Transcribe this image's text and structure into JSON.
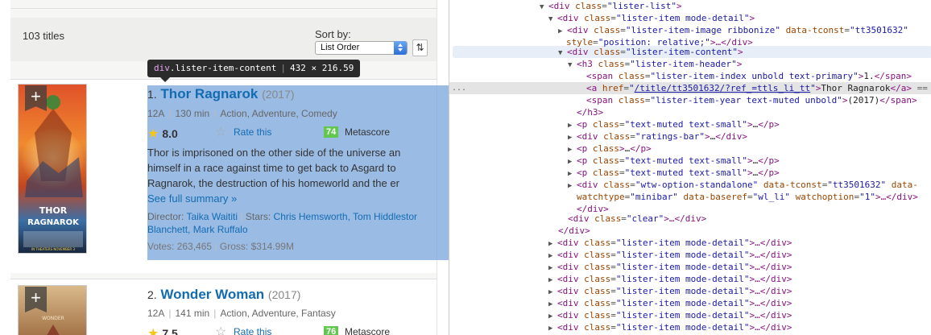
{
  "list_header": {
    "count": "103 titles",
    "sort_label": "Sort by:",
    "sort_value": "List Order",
    "sort_dir_icon": "⇅"
  },
  "tooltip": {
    "tag": "div",
    "cls": ".lister-item-content",
    "dims": "432 × 216.59"
  },
  "items": [
    {
      "index": "1.",
      "title": "Thor Ragnarok",
      "year": "(2017)",
      "certificate": "12A",
      "runtime": "130 min",
      "genre": "Action, Adventure, Comedy",
      "rating": "8.0",
      "rate_label": "Rate this",
      "metascore": "74",
      "metascore_label": "Metascore",
      "plot_lines": [
        "Thor is imprisoned on the other side of the universe an",
        "himself in a race against time to get back to Asgard to",
        "Ragnarok, the destruction of his homeworld and the er"
      ],
      "summary_link": "See full summary",
      "summary_arrow": "»",
      "director_label": "Director:",
      "director": "Taika Waititi",
      "stars_label": "Stars:",
      "stars_line1": "Chris Hemsworth, Tom Hiddlestor",
      "stars_line2": "Blanchett, Mark Ruffalo",
      "votes_label": "Votes:",
      "votes": "263,465",
      "gross_label": "Gross:",
      "gross": "$314.99M",
      "poster_text_top": "THOR",
      "poster_text_bottom": "RAGNAROK",
      "poster_date": "IN THEATERS NOVEMBER 3"
    },
    {
      "index": "2.",
      "title": "Wonder Woman",
      "year": "(2017)",
      "certificate": "12A",
      "runtime": "141 min",
      "genre": "Action, Adventure, Fantasy",
      "rating": "7.5",
      "rate_label": "Rate this",
      "metascore": "76",
      "metascore_label": "Metascore",
      "poster_text_top": "WONDER"
    }
  ],
  "ribbon_plus": "+",
  "devtools": {
    "lines": [
      {
        "t": "▼",
        "html": "<div class=\"lister-list\">",
        "tag": "div",
        "attrs": [
          [
            "class",
            "lister-list"
          ]
        ],
        "close": ">"
      },
      {
        "t": "▼",
        "tag": "div",
        "attrs": [
          [
            "class",
            "lister-item mode-detail"
          ]
        ]
      },
      {
        "t": "▶",
        "tag": "div",
        "attrs": [
          [
            "class",
            "lister-item-image ribbonize"
          ],
          [
            "data-tconst",
            "tt3501632"
          ]
        ],
        "tail": ""
      },
      {
        "t": "",
        "cont": "style=\"position: relative;\">…</div>"
      },
      {
        "t": "▼",
        "tag": "div",
        "attrs": [
          [
            "class",
            "lister-item-content"
          ]
        ]
      },
      {
        "t": "▼",
        "tag": "h3",
        "attrs": [
          [
            "class",
            "lister-item-header"
          ]
        ]
      },
      {
        "t": "",
        "span1": true
      },
      {
        "t": "",
        "link": true
      },
      {
        "t": "",
        "span2": true
      },
      {
        "t": "",
        "close": "</h3>"
      },
      {
        "t": "▶",
        "p": "p class=\"text-muted text-small\""
      },
      {
        "t": "▶",
        "p": "div class=\"ratings-bar\""
      },
      {
        "t": "▶",
        "p": "p class=\"\""
      },
      {
        "t": "▶",
        "p": "p class=\"text-muted text-small\""
      },
      {
        "t": "▶",
        "p": "p class=\"text-muted text-small\""
      },
      {
        "t": "▶",
        "wtw": true
      },
      {
        "t": "",
        "close": "</div>"
      },
      {
        "t": "",
        "clear": true
      },
      {
        "t": "",
        "close": "</div>"
      }
    ],
    "text": {
      "l0_tag": "div",
      "l0_attr": "class",
      "l0_val": "lister-list",
      "l1_tag": "div",
      "l1_attr": "class",
      "l1_val": "lister-item mode-detail",
      "l2_tag": "div",
      "l2_attr": "class",
      "l2_val": "lister-item-image ribbonize",
      "l2_attr2": "data-tconst",
      "l2_val2": "tt3501632",
      "l3_attr": "style",
      "l3_val": "position: relative;",
      "l3_rest": "…</div>",
      "l4_tag": "div",
      "l4_attr": "class",
      "l4_val": "lister-item-content",
      "l5_tag": "h3",
      "l5_attr": "class",
      "l5_val": "lister-item-header",
      "l6_tag": "span",
      "l6_attr": "class",
      "l6_val": "lister-item-index unbold text-primary",
      "l6_text": "1.",
      "l6_close": "span",
      "l7_tag": "a",
      "l7_attr": "href",
      "l7_val": "/title/tt3501632/?ref_=ttls_li_tt",
      "l7_text": "Thor Ragnarok",
      "l7_close": "a",
      "l7_marker": "==",
      "l8_tag": "span",
      "l8_attr": "class",
      "l8_val": "lister-item-year text-muted unbold",
      "l8_text": "(2017)",
      "l8_close": "span",
      "l9_close": "h3",
      "l10_tag": "p",
      "l10_attr": "class",
      "l10_val": "text-muted text-small",
      "l10_mid": "…",
      "l10_close": "p",
      "l11_tag": "div",
      "l11_attr": "class",
      "l11_val": "ratings-bar",
      "l11_mid": "…",
      "l11_close": "div",
      "l12_tag": "p",
      "l12_attr": "class",
      "l12_mid": "…",
      "l12_close": "p",
      "l13_tag": "p",
      "l13_attr": "class",
      "l13_val": "text-muted text-small",
      "l13_mid": "…",
      "l13_close": "p",
      "l14_tag": "p",
      "l14_attr": "class",
      "l14_val": "text-muted text-small",
      "l14_mid": "…",
      "l14_close": "p",
      "l15_tag": "div",
      "l15_attr": "class",
      "l15_val": "wtw-option-standalone",
      "l15_attr2": "data-tconst",
      "l15_val2": "tt3501632",
      "l15_attr3": "data-",
      "l16_attr": "watchtype",
      "l16_val": "minibar",
      "l16_attr2": "data-baseref",
      "l16_val2": "wl_li",
      "l16_attr3": "watchoption",
      "l16_val3": "1",
      "l16_rest": "…</div>",
      "l17_close": "div",
      "l18_tag": "div",
      "l18_attr": "class",
      "l18_val": "clear",
      "l18_rest": "…</div>",
      "l19_close": "div",
      "collapsed_tag": "div",
      "collapsed_attr": "class",
      "collapsed_val": "lister-item mode-detail",
      "collapsed_rest": "…</div>"
    },
    "gutter_dots": "..."
  }
}
